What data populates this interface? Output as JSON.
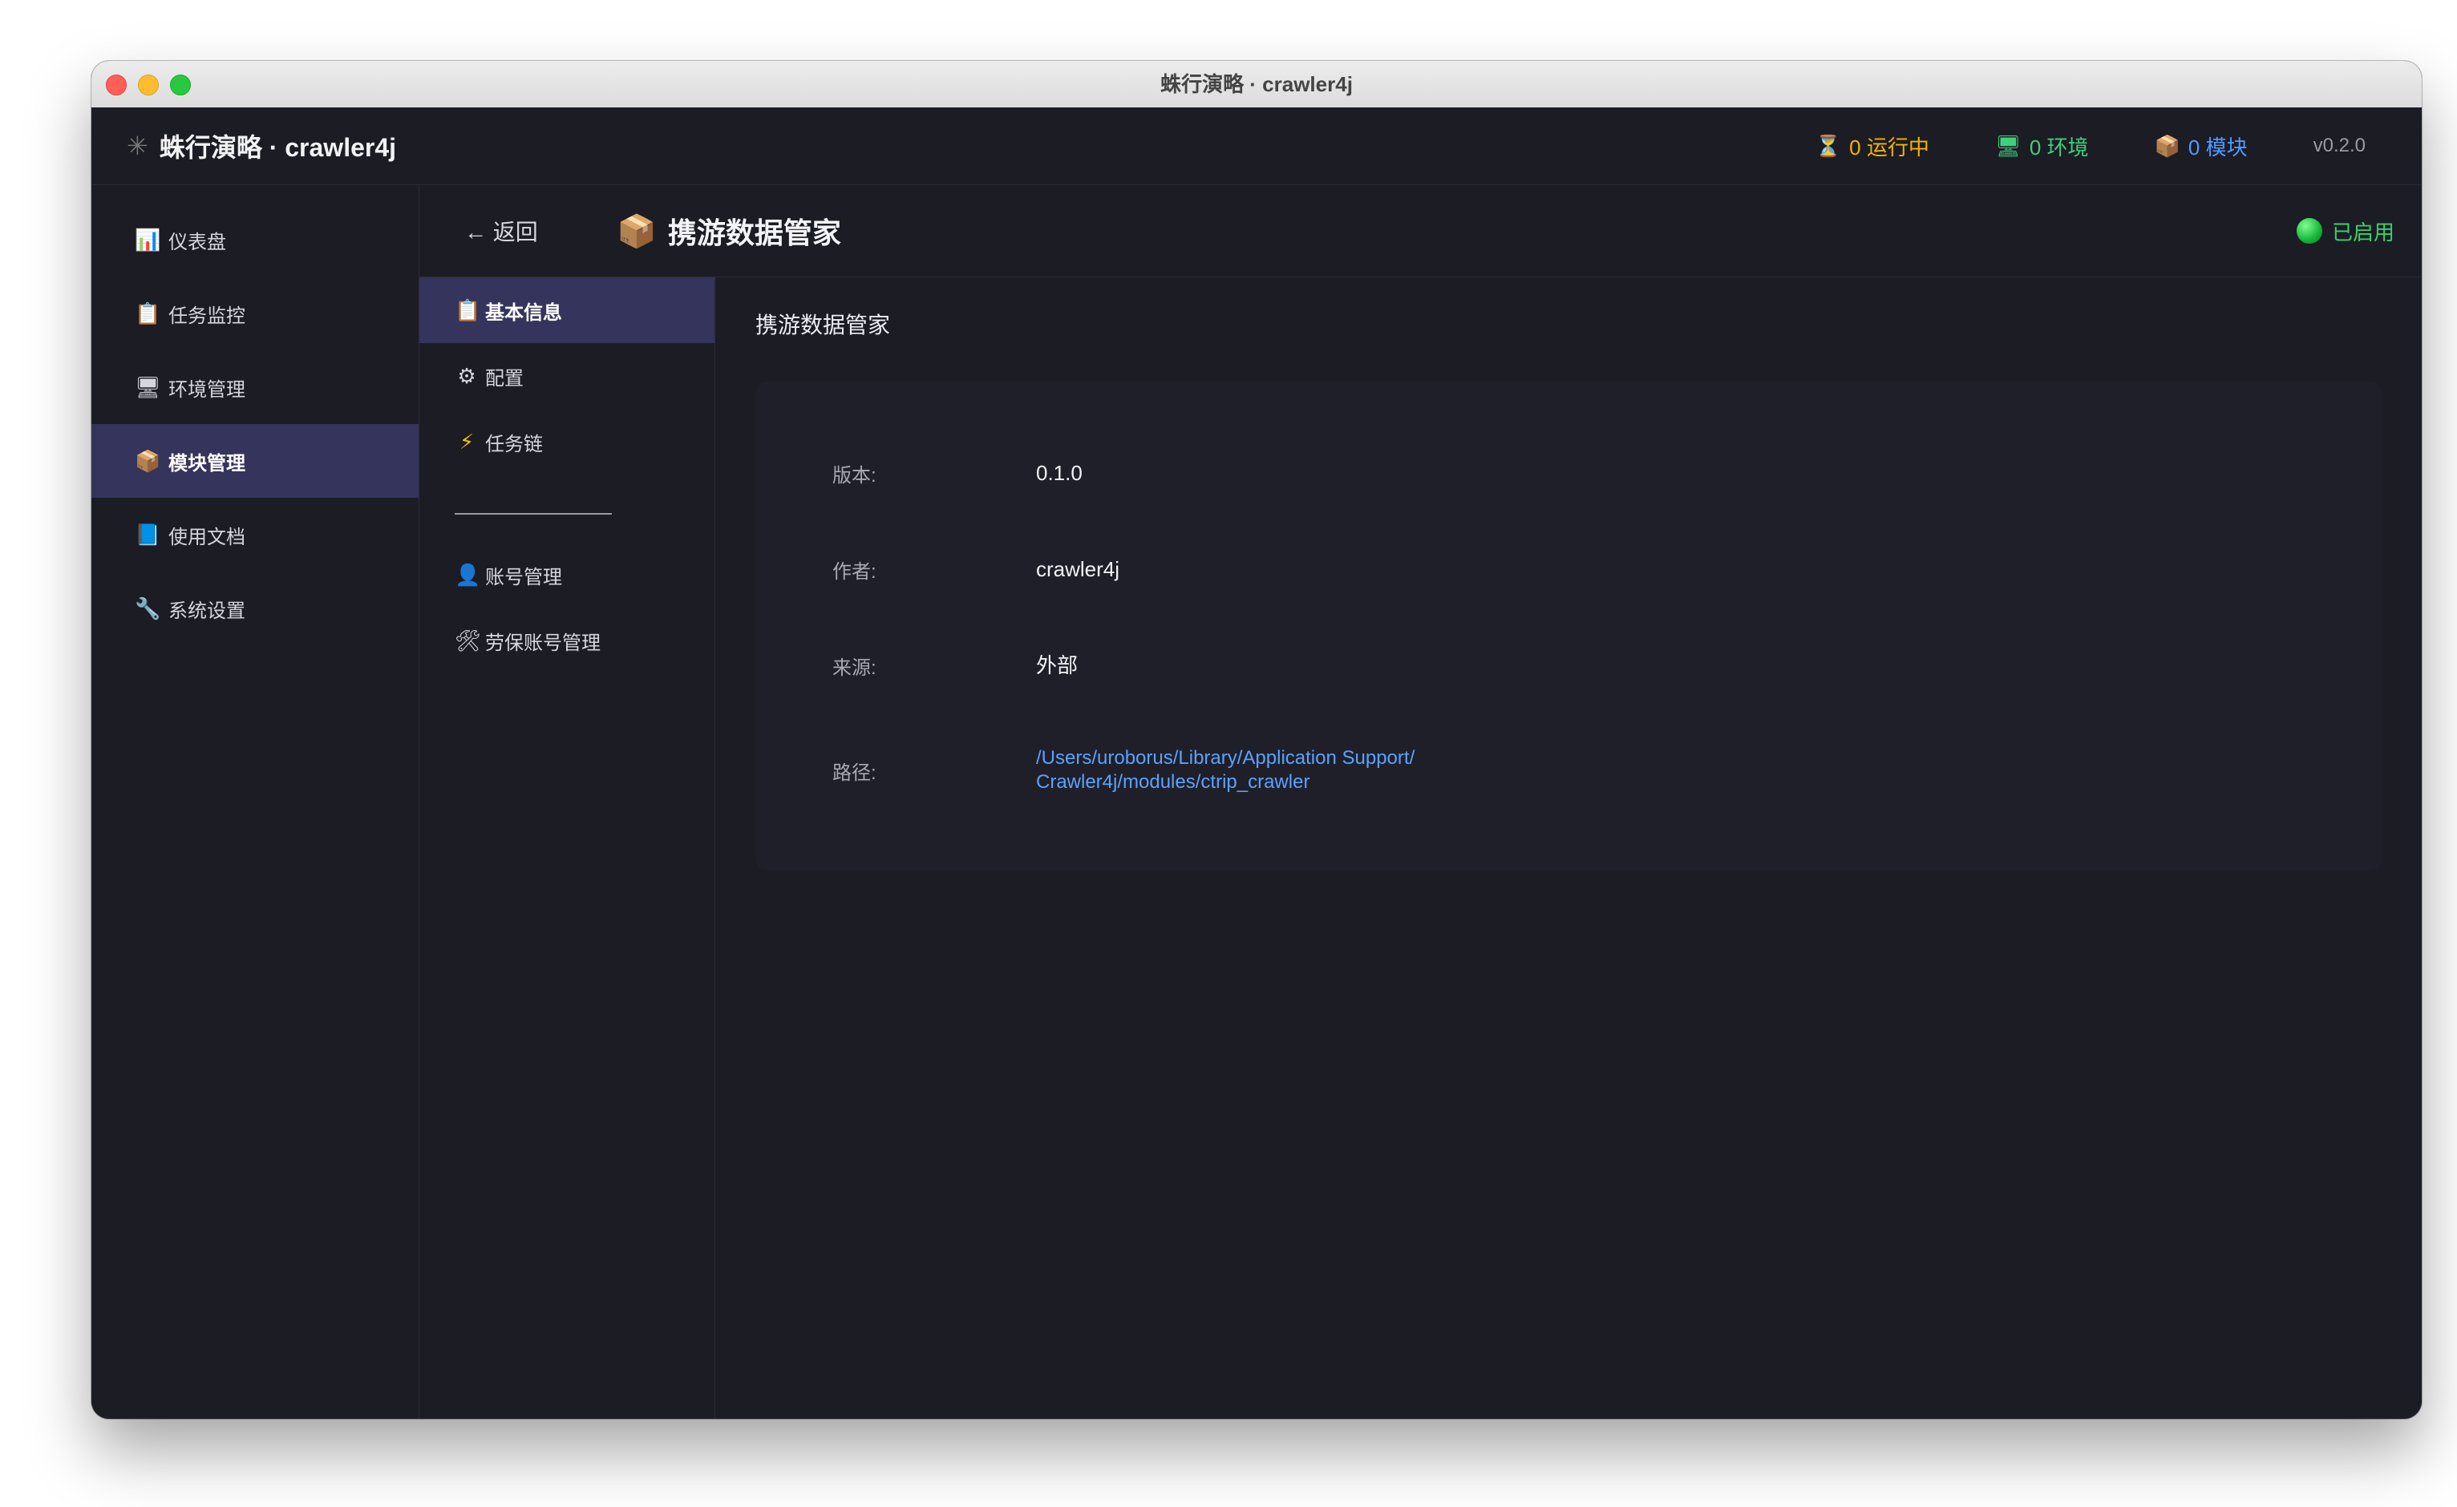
{
  "window": {
    "title": "蛛行演略 · crawler4j"
  },
  "app": {
    "brand_icon": "spider-icon",
    "brand_text": "蛛行演略 · crawler4j",
    "stats": [
      {
        "icon": "hourglass-icon",
        "glyph": "⏳",
        "label": "0 运行中",
        "color": "#f5b400"
      },
      {
        "icon": "monitor-icon",
        "glyph": "🖥",
        "label": "0 环境",
        "color": "#3ed17a"
      },
      {
        "icon": "package-icon",
        "glyph": "📦",
        "label": "0 模块",
        "color": "#4f9bff"
      }
    ],
    "version": "v0.2.0"
  },
  "sidebar": {
    "items": [
      {
        "icon": "chart-icon",
        "glyph": "📊",
        "label": "仪表盘",
        "active": false
      },
      {
        "icon": "clipboard-icon",
        "glyph": "📋",
        "label": "任务监控",
        "active": false
      },
      {
        "icon": "monitor-icon",
        "glyph": "🖥",
        "label": "环境管理",
        "active": false
      },
      {
        "icon": "package-icon",
        "glyph": "📦",
        "label": "模块管理",
        "active": true
      },
      {
        "icon": "book-icon",
        "glyph": "📘",
        "label": "使用文档",
        "active": false
      },
      {
        "icon": "wrench-icon",
        "glyph": "🔧",
        "label": "系统设置",
        "active": false
      }
    ]
  },
  "header": {
    "back_icon": "arrow-left-icon",
    "back_label": "← 返回",
    "title_icon": "package-icon",
    "title": "携游数据管家",
    "status_label": "已启用",
    "status_color": "#37d36a"
  },
  "subnav": {
    "items": [
      {
        "icon": "clipboard-icon",
        "glyph": "📋",
        "label": "基本信息",
        "active": true
      },
      {
        "icon": "gear-icon",
        "glyph": "⚙",
        "label": "配置",
        "active": false
      },
      {
        "icon": "lightning-icon",
        "glyph": "⚡",
        "label": "任务链",
        "active": false
      },
      {
        "icon": "user-icon",
        "glyph": "👤",
        "label": "账号管理",
        "active": false
      },
      {
        "icon": "tools-icon",
        "glyph": "🛠",
        "label": "劳保账号管理",
        "active": false
      }
    ]
  },
  "detail": {
    "section_title": "携游数据管家",
    "rows": [
      {
        "label": "版本:",
        "value": "0.1.0"
      },
      {
        "label": "作者:",
        "value": "crawler4j"
      },
      {
        "label": "来源:",
        "value": "外部"
      },
      {
        "label": "路径:",
        "value_line1": "/Users/uroborus/Library/Application Support/",
        "value_line2": "Crawler4j/modules/ctrip_crawler"
      }
    ]
  }
}
